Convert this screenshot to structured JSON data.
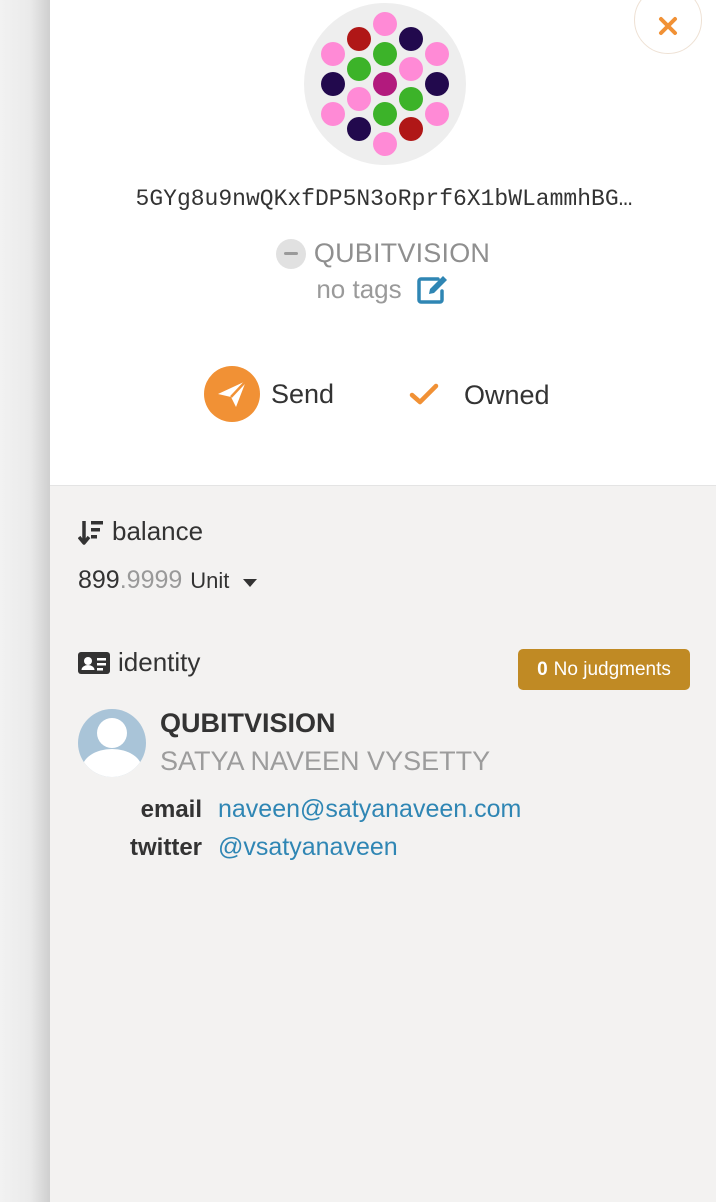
{
  "account": {
    "address": "5GYg8u9nwQKxfDP5N3oRprf6X1bWLammhBG…",
    "name": "QUBITVISION",
    "tags": "no tags"
  },
  "actions": {
    "send_label": "Send",
    "owned_label": "Owned"
  },
  "balance": {
    "heading": "balance",
    "integer": "899",
    "decimal": ".9999",
    "unit": "Unit"
  },
  "identity": {
    "heading": "identity",
    "judgments_count": "0",
    "judgments_label": "No judgments",
    "display_name": "QUBITVISION",
    "legal_name": "SATYA NAVEEN VYSETTY",
    "fields": [
      {
        "label": "email",
        "value": "naveen@satyanaveen.com"
      },
      {
        "label": "twitter",
        "value": "@vsatyanaveen"
      }
    ]
  },
  "colors": {
    "accent_orange": "#f19135",
    "link_blue": "#2f86b4",
    "badge_gold": "#c08a24",
    "identicon_pink": "#ff8ad6",
    "identicon_red": "#b01717",
    "identicon_green": "#3cb329",
    "identicon_navy": "#22094d",
    "identicon_magenta": "#b21a7d"
  },
  "icons": {
    "close": "close-icon",
    "name_status": "minus-circle-icon",
    "edit_tags": "edit-icon",
    "send": "paper-plane-icon",
    "owned": "check-icon",
    "balance": "sort-amount-down-icon",
    "identity": "id-card-icon",
    "balance_expand": "caret-down-icon",
    "avatar": "user-avatar-icon"
  }
}
